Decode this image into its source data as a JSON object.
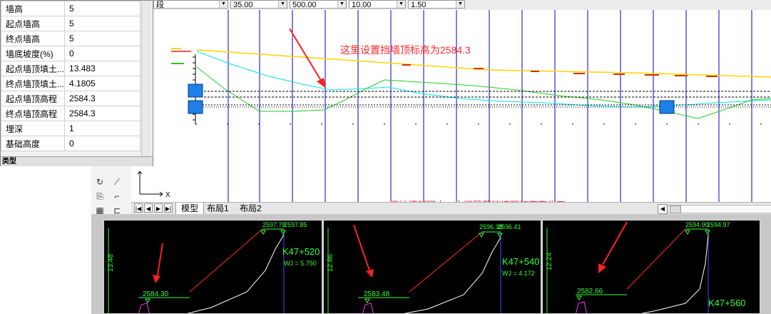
{
  "toolbar": {
    "field0": "段",
    "field1": "35.00",
    "field2": "500.00",
    "field3": "10.00",
    "field4": "1.50"
  },
  "properties": {
    "rows": [
      {
        "key": "墙高",
        "value": "5"
      },
      {
        "key": "起点墙高",
        "value": "5"
      },
      {
        "key": "终点墙高",
        "value": "5"
      },
      {
        "key": "墙底坡度(%)",
        "value": "0"
      },
      {
        "key": "起点墙顶填土...",
        "value": "13.483"
      },
      {
        "key": "终点墙顶填土...",
        "value": "4.1805"
      },
      {
        "key": "起点墙顶高程",
        "value": "2584.3"
      },
      {
        "key": "终点墙顶高程",
        "value": "2584.3"
      },
      {
        "key": "埋深",
        "value": "1"
      },
      {
        "key": "基础高度",
        "value": "0"
      }
    ],
    "group_label": "类型"
  },
  "tabs": {
    "model": "模型",
    "layout1": "布局1",
    "layout2": "布局2"
  },
  "annotations": {
    "top": "这里设置挡墙顶标高为2584.3",
    "middle": "逐桩细部图中，中间段落挡墙顶标高变化了"
  },
  "ucs": {
    "x": "X"
  },
  "panes": [
    {
      "station": "K47+520",
      "wj": "WJ = 5.750",
      "top_left": "2597.78",
      "top_right": "2597.85",
      "wall_top": "2584.30",
      "height": "13.48"
    },
    {
      "station": "K47+540",
      "wj": "WJ = 4.172",
      "top_left": "2596.38",
      "top_right": "2596.41",
      "wall_top": "2583.48",
      "height": "12.86"
    },
    {
      "station": "K47+560",
      "wj": "",
      "top_left": "2594.90",
      "top_right": "2594.97",
      "wall_top": "2582.66",
      "height": "12.24"
    }
  ],
  "colors": {
    "grid_line": "#0000cc",
    "ground_line": "#22cc22",
    "design_line": "#ffd400",
    "cyan_line": "#00e5ee",
    "annotation": "#ff2a2a",
    "cad_green": "#33ff33"
  }
}
